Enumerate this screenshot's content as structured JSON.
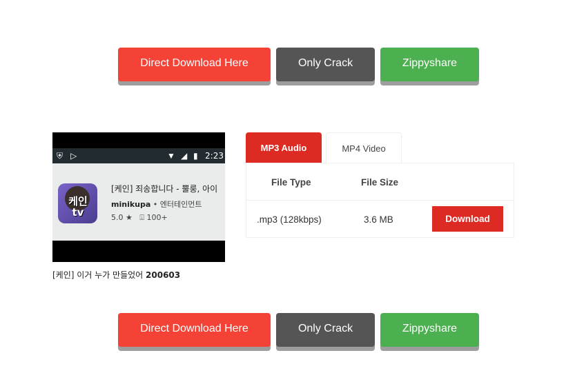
{
  "download_buttons": {
    "direct": "Direct Download Here",
    "crack": "Only Crack",
    "zippyshare": "Zippyshare"
  },
  "video": {
    "statusbar_time": "2:23",
    "app_icon_text": "케인\ntv",
    "app_title": "[케인] 죄송합니다 - 뿔룽, 아이",
    "developer": "minikupa",
    "category": "엔터테인먼트",
    "rating": "5.0 ★",
    "downloads": "100+",
    "caption_prefix": "[케인] 이거 누가 만들었어 ",
    "caption_code": "200603"
  },
  "tabs": [
    {
      "label": "MP3 Audio",
      "active": true
    },
    {
      "label": "MP4 Video",
      "active": false
    }
  ],
  "table": {
    "headers": [
      "File Type",
      "File Size"
    ],
    "rows": [
      {
        "type": ".mp3 (128kbps)",
        "size": "3.6 MB",
        "action": "Download"
      }
    ]
  },
  "colors": {
    "red": "#f44336",
    "dark": "#555555",
    "green": "#4caf50",
    "accent": "#dd2a22"
  }
}
